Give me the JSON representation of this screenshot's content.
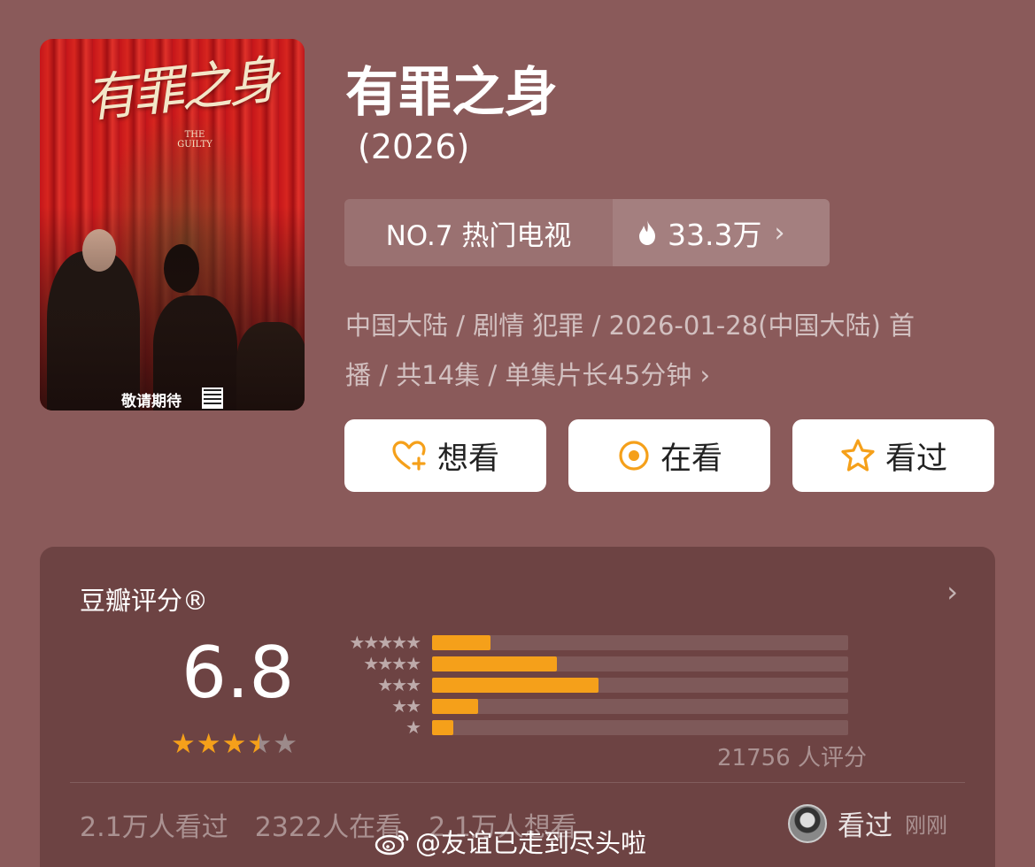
{
  "poster": {
    "title_art": "有罪之身",
    "title_en": "THE GUILTY",
    "tagline": "敬请期待"
  },
  "header": {
    "title": "有罪之身",
    "year": "(2026)"
  },
  "rank": {
    "label": "NO.7 热门电视",
    "heat": "33.3万",
    "chevron": "›"
  },
  "meta": {
    "line1": "中国大陆 / 剧情 犯罪 / 2026-01-28(中国大陆) 首",
    "line2": "播 / 共14集 / 单集片长45分钟",
    "chevron": "›"
  },
  "buttons": {
    "want": "想看",
    "watching": "在看",
    "watched": "看过"
  },
  "rating": {
    "title": "豆瓣评分®",
    "chevron": "›",
    "score": "6.8",
    "stars_filled": 3.5,
    "distribution": [
      {
        "stars": 5,
        "label": "★★★★★",
        "fraction": 0.14
      },
      {
        "stars": 4,
        "label": "★★★★",
        "fraction": 0.3
      },
      {
        "stars": 3,
        "label": "★★★",
        "fraction": 0.4
      },
      {
        "stars": 2,
        "label": "★★",
        "fraction": 0.11
      },
      {
        "stars": 1,
        "label": "★",
        "fraction": 0.05
      }
    ],
    "count": "21756 人评分"
  },
  "stats": {
    "watched": "2.1万人看过",
    "watching": "2322人在看",
    "want": "2.1万人想看"
  },
  "me": {
    "status": "看过",
    "when": "刚刚"
  },
  "watermark": "@友谊已走到尽头啦",
  "colors": {
    "background": "#8a5a5a",
    "accent": "#f5a01a",
    "star_empty": "#9c8a8a"
  }
}
